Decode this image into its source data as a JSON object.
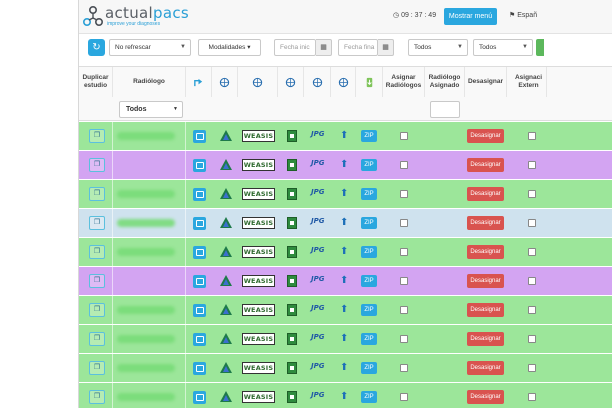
{
  "header": {
    "logo_main": "actual",
    "logo_accent": "pacs",
    "logo_tagline": "improve your diagnoses",
    "clock": "09 : 37 : 49",
    "menu_button": "Mostrar menú",
    "language": "Españ"
  },
  "toolbar": {
    "refresh_select": "No refrescar",
    "modalities_button": "Modalidades",
    "date_from_placeholder": "Fecha inic",
    "date_to_placeholder": "Fecha fina",
    "filter1": "Todos",
    "filter2": "Todos"
  },
  "table": {
    "columns": {
      "duplicate": "Duplicar estudio",
      "radiologist": "Radiólogo",
      "assign_radiologists": "Asignar Radiólogos",
      "assigned_radiologist": "Radiólogo Asignado",
      "unassign": "Desasignar",
      "external": "Asignaci Extern"
    },
    "radiologist_filter": "Todos",
    "weasis_label": "WEASIS",
    "jpg_label": "JPG",
    "zip_label": "ZIP",
    "unassign_label": "Desasignar",
    "rows": [
      {
        "color": "green"
      },
      {
        "color": "purple"
      },
      {
        "color": "green"
      },
      {
        "color": "blue"
      },
      {
        "color": "green"
      },
      {
        "color": "purple"
      },
      {
        "color": "green"
      },
      {
        "color": "green"
      },
      {
        "color": "green"
      },
      {
        "color": "green"
      }
    ]
  },
  "colors": {
    "accent": "#2aa7df",
    "green_row": "#9ce69a",
    "purple_row": "#d3a4f2",
    "blue_row": "#cfe2ee",
    "danger": "#d9534f"
  }
}
